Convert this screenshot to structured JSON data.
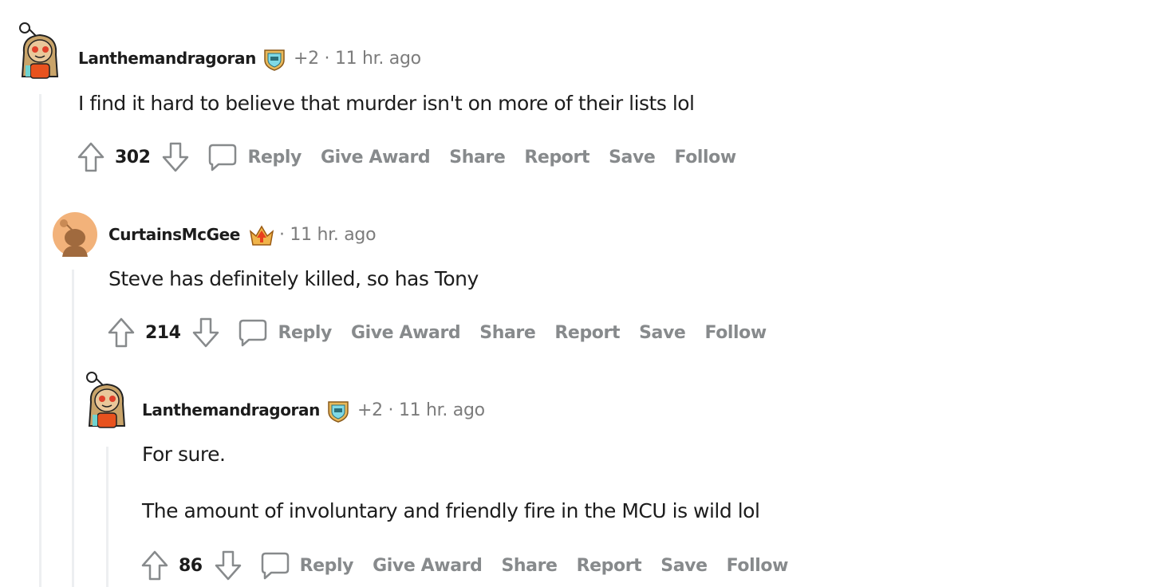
{
  "comments": [
    {
      "username": "Lanthemandragoran",
      "flair_icon": "award-shield-icon",
      "extra": "+2",
      "separator": "·",
      "time": "11 hr. ago",
      "body": [
        "I find it hard to believe that murder isn't on more of their lists lol"
      ],
      "score": "302",
      "avatar": "snoo-avatar-long-hair"
    },
    {
      "username": "CurtainsMcGee",
      "flair_icon": "award-crown-icon",
      "extra": "",
      "separator": "·",
      "time": "11 hr. ago",
      "body": [
        "Steve has definitely killed, so has Tony"
      ],
      "score": "214",
      "avatar": "default-snoo-avatar"
    },
    {
      "username": "Lanthemandragoran",
      "flair_icon": "award-shield-icon",
      "extra": "+2",
      "separator": "·",
      "time": "11 hr. ago",
      "body": [
        "For sure.",
        "The amount of involuntary and friendly fire in the MCU is wild lol"
      ],
      "score": "86",
      "avatar": "snoo-avatar-long-hair"
    }
  ],
  "actions": {
    "reply": "Reply",
    "give_award": "Give Award",
    "share": "Share",
    "report": "Report",
    "save": "Save",
    "follow": "Follow"
  },
  "colors": {
    "text": "#1c1c1c",
    "muted": "#878a8c",
    "thread_line": "#edeff1",
    "avatar_orange": "#f2b27a"
  }
}
